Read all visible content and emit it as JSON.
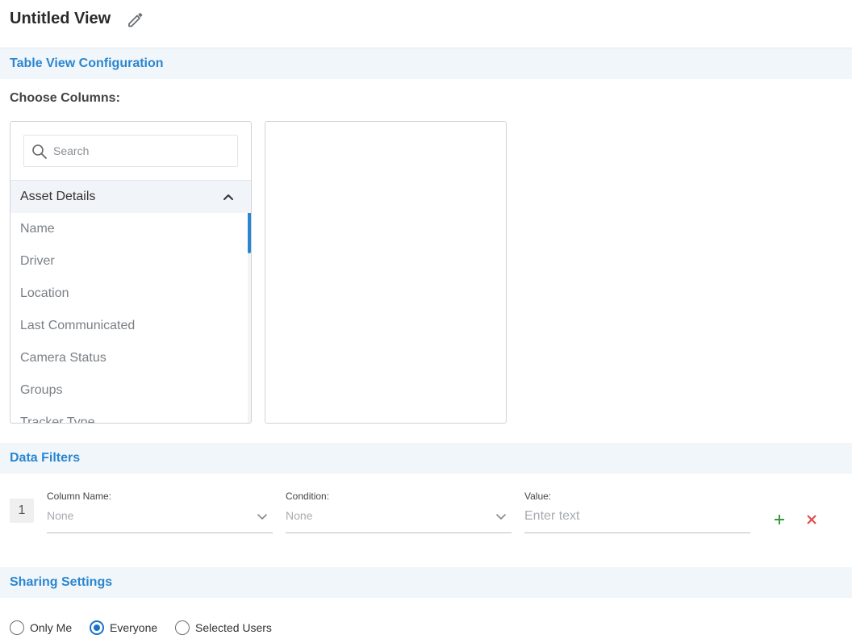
{
  "header": {
    "title": "Untitled View",
    "edit_icon": "pencil-icon"
  },
  "table_config": {
    "section_title": "Table View Configuration",
    "choose_columns_label": "Choose Columns:",
    "search": {
      "placeholder": "Search",
      "value": ""
    },
    "group": {
      "label": "Asset Details",
      "expanded": true
    },
    "items": [
      "Name",
      "Driver",
      "Location",
      "Last Communicated",
      "Camera Status",
      "Groups",
      "Tracker Type"
    ]
  },
  "data_filters": {
    "section_title": "Data Filters",
    "rows": [
      {
        "index": "1",
        "column_name": {
          "label": "Column Name:",
          "value": "None"
        },
        "condition": {
          "label": "Condition:",
          "value": "None"
        },
        "value": {
          "label": "Value:",
          "placeholder": "Enter text",
          "value": ""
        }
      }
    ],
    "colors": {
      "add": "#3a9a3a",
      "remove": "#e04848"
    }
  },
  "sharing": {
    "section_title": "Sharing Settings",
    "options": [
      {
        "label": "Only Me",
        "checked": false
      },
      {
        "label": "Everyone",
        "checked": true
      },
      {
        "label": "Selected Users",
        "checked": false
      }
    ]
  },
  "colors": {
    "accent": "#2a86cf",
    "section_bg": "#f1f6fb"
  }
}
